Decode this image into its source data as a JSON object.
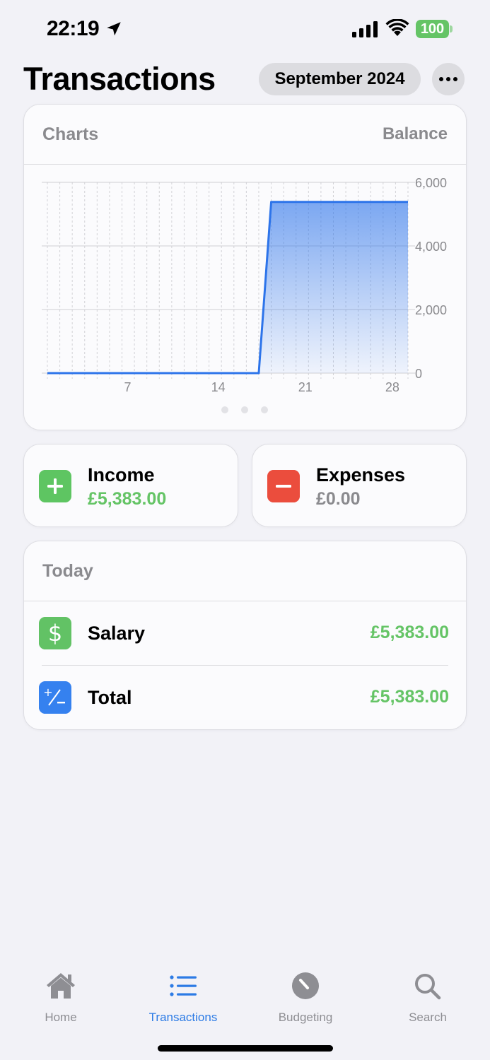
{
  "status": {
    "time": "22:19",
    "battery": "100"
  },
  "header": {
    "title": "Transactions",
    "month": "September 2024"
  },
  "chart_card": {
    "left_label": "Charts",
    "right_label": "Balance"
  },
  "chart_data": {
    "type": "area",
    "title": "",
    "series": [
      {
        "values": [
          [
            1,
            0
          ],
          [
            18,
            0
          ],
          [
            19,
            5383
          ],
          [
            30,
            5383
          ]
        ]
      }
    ],
    "x_ticks": [
      7,
      14,
      21,
      28
    ],
    "y_ticks": [
      0,
      2000,
      4000,
      6000
    ],
    "y_tick_labels": [
      "0",
      "2,000",
      "4,000",
      "6,000"
    ],
    "xlim": [
      1,
      30
    ],
    "ylim": [
      0,
      6000
    ],
    "color": "#2d74ea",
    "grid": true
  },
  "income": {
    "label": "Income",
    "value": "£5,383.00"
  },
  "expenses": {
    "label": "Expenses",
    "value": "£0.00"
  },
  "list": {
    "header": "Today",
    "rows": [
      {
        "label": "Salary",
        "value": "£5,383.00"
      },
      {
        "label": "Total",
        "value": "£5,383.00"
      }
    ]
  },
  "tabs": [
    {
      "label": "Home",
      "icon": "house-icon"
    },
    {
      "label": "Transactions",
      "icon": "list-icon"
    },
    {
      "label": "Budgeting",
      "icon": "gauge-icon"
    },
    {
      "label": "Search",
      "icon": "magnifier-icon"
    }
  ],
  "colors": {
    "accent": "#2c7be5",
    "income": "#65c466",
    "expense": "#eb4d3d"
  }
}
